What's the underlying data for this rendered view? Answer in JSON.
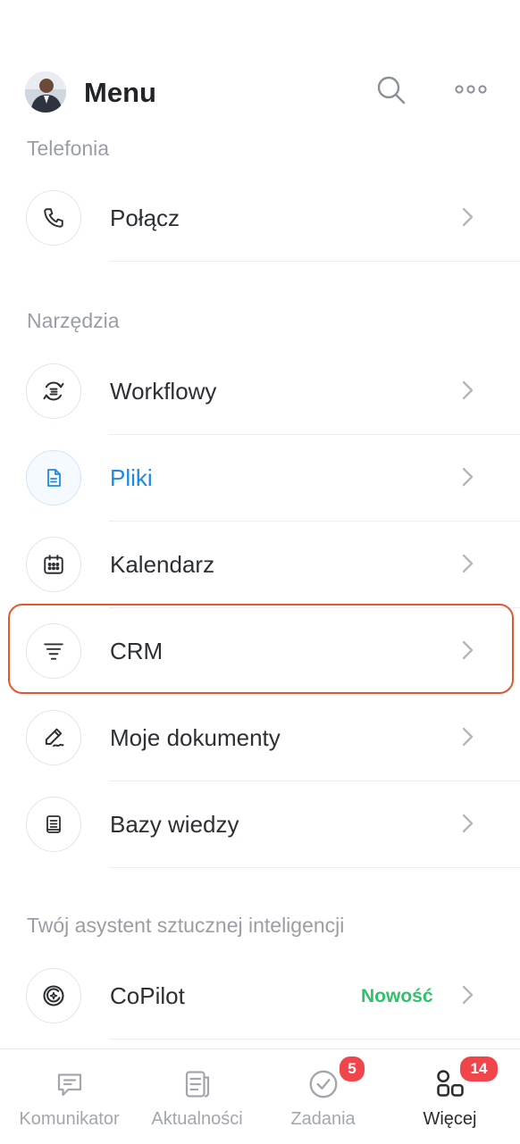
{
  "header": {
    "title": "Menu",
    "search_icon": "search-icon",
    "more_icon": "more-horizontal-icon"
  },
  "sections": [
    {
      "label": "Telefonia",
      "items": [
        {
          "label": "Połącz",
          "icon": "phone-icon"
        }
      ]
    },
    {
      "label": "Narzędzia",
      "items": [
        {
          "label": "Workflowy",
          "icon": "workflow-icon"
        },
        {
          "label": "Pliki",
          "icon": "file-icon",
          "active": true
        },
        {
          "label": "Kalendarz",
          "icon": "calendar-icon"
        },
        {
          "label": "CRM",
          "icon": "funnel-icon",
          "highlighted": true
        },
        {
          "label": "Moje dokumenty",
          "icon": "pen-signature-icon"
        },
        {
          "label": "Bazy wiedzy",
          "icon": "book-icon"
        }
      ]
    },
    {
      "label": "Twój asystent sztucznej inteligencji",
      "items": [
        {
          "label": "CoPilot",
          "icon": "copilot-icon",
          "badge": "Nowość"
        }
      ]
    }
  ],
  "tabbar": {
    "tabs": [
      {
        "label": "Komunikator",
        "icon": "chat-icon"
      },
      {
        "label": "Aktualności",
        "icon": "news-icon"
      },
      {
        "label": "Zadania",
        "icon": "check-circle-icon",
        "count": "5"
      },
      {
        "label": "Więcej",
        "icon": "grid-icon",
        "count": "14",
        "active": true
      }
    ]
  },
  "colors": {
    "accent": "#1a8ae6",
    "highlight_border": "#e3572f",
    "badge_new": "#2fc26b",
    "count_badge": "#f0454a"
  }
}
